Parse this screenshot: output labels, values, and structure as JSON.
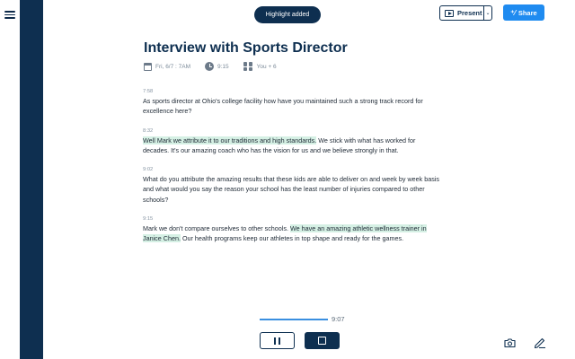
{
  "toast": {
    "text": "Highlight added"
  },
  "toolbar": {
    "present_label": "Present",
    "present_caret": "⌄",
    "share_label": "Share",
    "share_icon": "⁺⁄"
  },
  "document": {
    "title": "Interview with Sports Director",
    "meta": {
      "date": "Fri, 6/7 : 7AM",
      "duration": "9:15",
      "participants": "You + 6"
    }
  },
  "transcript": [
    {
      "time": "7:58",
      "segments": [
        {
          "text": "As sports director at Ohio's college facility how have you maintained such a strong track record for excellence here?",
          "highlight": false
        }
      ]
    },
    {
      "time": "8:32",
      "segments": [
        {
          "text": "Well Mark we attribute it to our traditions and high standards.",
          "highlight": true
        },
        {
          "text": " We stick with what has worked for decades. It's our amazing coach who has the vision for us and we believe strongly in that.",
          "highlight": false
        }
      ]
    },
    {
      "time": "9:02",
      "segments": [
        {
          "text": "What do you attribute the amazing results that these kids are able to deliver on and week by week basis and what would you say the reason your school has the least number of injuries compared to other schools?",
          "highlight": false
        }
      ]
    },
    {
      "time": "9:15",
      "segments": [
        {
          "text": "Mark we don't compare ourselves to other schools. ",
          "highlight": false
        },
        {
          "text": "We have an amazing athletic wellness trainer in Janice Chen.",
          "highlight": true
        },
        {
          "text": " Our health programs keep our athletes in top shape and ready for the games.",
          "highlight": false
        }
      ]
    }
  ],
  "player": {
    "time": "9:07"
  },
  "colors": {
    "navy": "#0e2f50",
    "accent": "#1f8bf0",
    "highlight": "#d5f0e4"
  }
}
